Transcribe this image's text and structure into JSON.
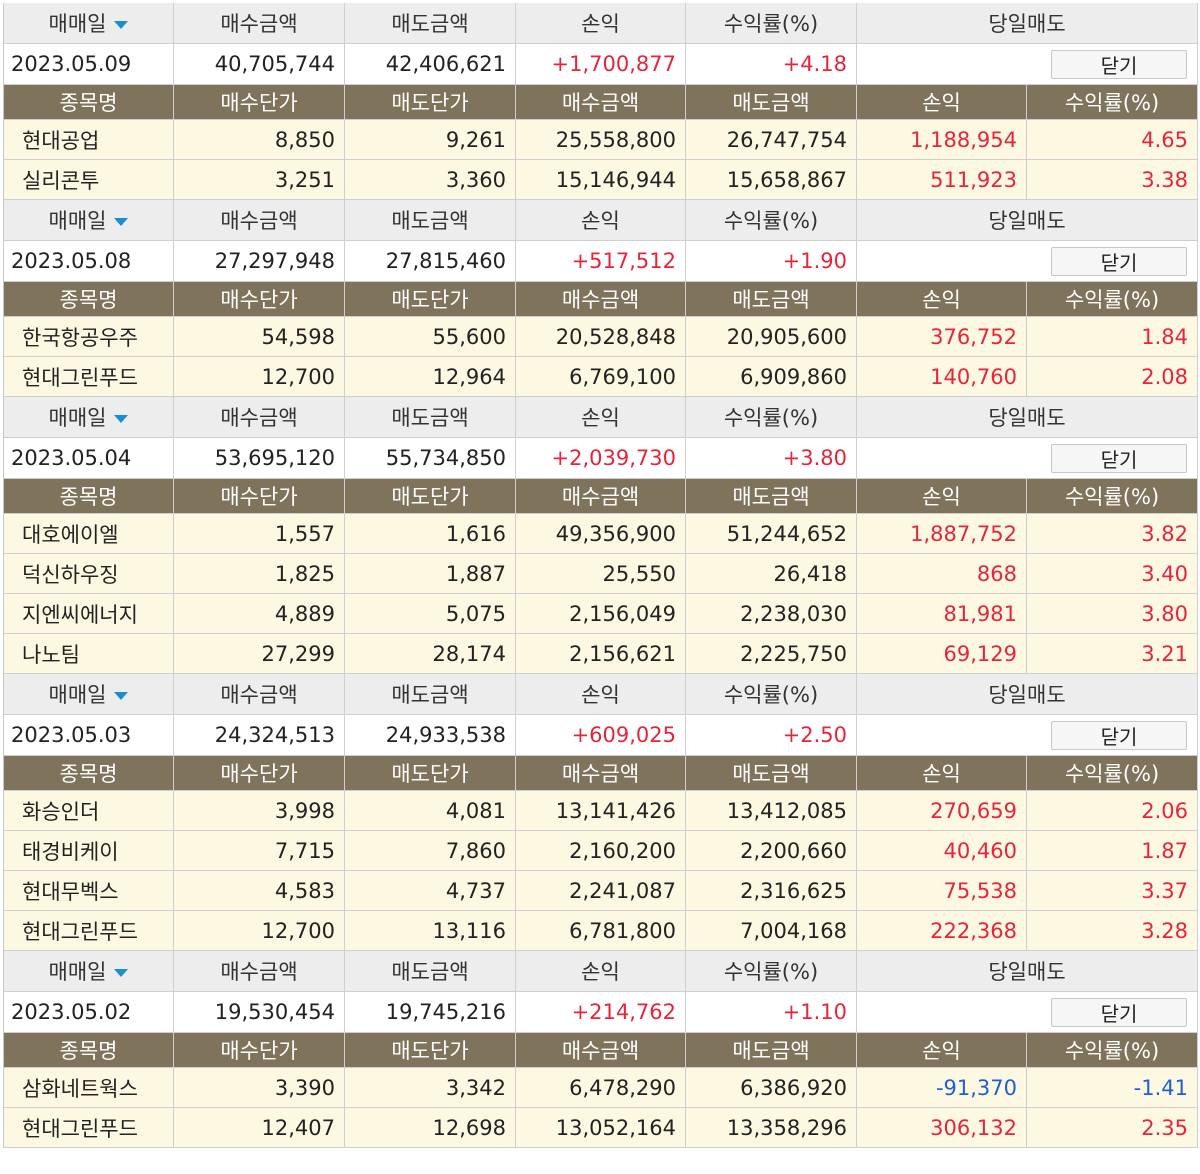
{
  "labels": {
    "trade_date": "매매일",
    "buy_amount": "매수금액",
    "sell_amount": "매도금액",
    "profit": "손익",
    "rate": "수익률(%)",
    "same_day_sell": "당일매도",
    "stock_name": "종목명",
    "buy_price": "매수단가",
    "sell_price": "매도단가",
    "close": "닫기"
  },
  "icons": {
    "sort": "sort-down-triangle-icon"
  },
  "colors": {
    "profit_positive": "#e8243a",
    "profit_negative": "#1e5fd6",
    "sub_header_bg": "#7f735b",
    "row_bg": "#fdf8e2",
    "sort_icon": "#1a8fd0"
  },
  "days": [
    {
      "date": "2023.05.09",
      "buy_amount": "40,705,744",
      "sell_amount": "42,406,621",
      "profit": "+1,700,877",
      "rate": "+4.18",
      "stocks": [
        {
          "name": "현대공업",
          "buy_price": "8,850",
          "sell_price": "9,261",
          "buy_amount": "25,558,800",
          "sell_amount": "26,747,754",
          "profit": "1,188,954",
          "rate": "4.65"
        },
        {
          "name": "실리콘투",
          "buy_price": "3,251",
          "sell_price": "3,360",
          "buy_amount": "15,146,944",
          "sell_amount": "15,658,867",
          "profit": "511,923",
          "rate": "3.38"
        }
      ]
    },
    {
      "date": "2023.05.08",
      "buy_amount": "27,297,948",
      "sell_amount": "27,815,460",
      "profit": "+517,512",
      "rate": "+1.90",
      "stocks": [
        {
          "name": "한국항공우주",
          "buy_price": "54,598",
          "sell_price": "55,600",
          "buy_amount": "20,528,848",
          "sell_amount": "20,905,600",
          "profit": "376,752",
          "rate": "1.84"
        },
        {
          "name": "현대그린푸드",
          "buy_price": "12,700",
          "sell_price": "12,964",
          "buy_amount": "6,769,100",
          "sell_amount": "6,909,860",
          "profit": "140,760",
          "rate": "2.08"
        }
      ]
    },
    {
      "date": "2023.05.04",
      "buy_amount": "53,695,120",
      "sell_amount": "55,734,850",
      "profit": "+2,039,730",
      "rate": "+3.80",
      "stocks": [
        {
          "name": "대호에이엘",
          "buy_price": "1,557",
          "sell_price": "1,616",
          "buy_amount": "49,356,900",
          "sell_amount": "51,244,652",
          "profit": "1,887,752",
          "rate": "3.82"
        },
        {
          "name": "덕신하우징",
          "buy_price": "1,825",
          "sell_price": "1,887",
          "buy_amount": "25,550",
          "sell_amount": "26,418",
          "profit": "868",
          "rate": "3.40"
        },
        {
          "name": "지엔씨에너지",
          "buy_price": "4,889",
          "sell_price": "5,075",
          "buy_amount": "2,156,049",
          "sell_amount": "2,238,030",
          "profit": "81,981",
          "rate": "3.80"
        },
        {
          "name": "나노팀",
          "buy_price": "27,299",
          "sell_price": "28,174",
          "buy_amount": "2,156,621",
          "sell_amount": "2,225,750",
          "profit": "69,129",
          "rate": "3.21"
        }
      ]
    },
    {
      "date": "2023.05.03",
      "buy_amount": "24,324,513",
      "sell_amount": "24,933,538",
      "profit": "+609,025",
      "rate": "+2.50",
      "stocks": [
        {
          "name": "화승인더",
          "buy_price": "3,998",
          "sell_price": "4,081",
          "buy_amount": "13,141,426",
          "sell_amount": "13,412,085",
          "profit": "270,659",
          "rate": "2.06"
        },
        {
          "name": "태경비케이",
          "buy_price": "7,715",
          "sell_price": "7,860",
          "buy_amount": "2,160,200",
          "sell_amount": "2,200,660",
          "profit": "40,460",
          "rate": "1.87"
        },
        {
          "name": "현대무벡스",
          "buy_price": "4,583",
          "sell_price": "4,737",
          "buy_amount": "2,241,087",
          "sell_amount": "2,316,625",
          "profit": "75,538",
          "rate": "3.37"
        },
        {
          "name": "현대그린푸드",
          "buy_price": "12,700",
          "sell_price": "13,116",
          "buy_amount": "6,781,800",
          "sell_amount": "7,004,168",
          "profit": "222,368",
          "rate": "3.28"
        }
      ]
    },
    {
      "date": "2023.05.02",
      "buy_amount": "19,530,454",
      "sell_amount": "19,745,216",
      "profit": "+214,762",
      "rate": "+1.10",
      "stocks": [
        {
          "name": "삼화네트웍스",
          "buy_price": "3,390",
          "sell_price": "3,342",
          "buy_amount": "6,478,290",
          "sell_amount": "6,386,920",
          "profit": "-91,370",
          "rate": "-1.41"
        },
        {
          "name": "현대그린푸드",
          "buy_price": "12,407",
          "sell_price": "12,698",
          "buy_amount": "13,052,164",
          "sell_amount": "13,358,296",
          "profit": "306,132",
          "rate": "2.35"
        }
      ]
    }
  ]
}
